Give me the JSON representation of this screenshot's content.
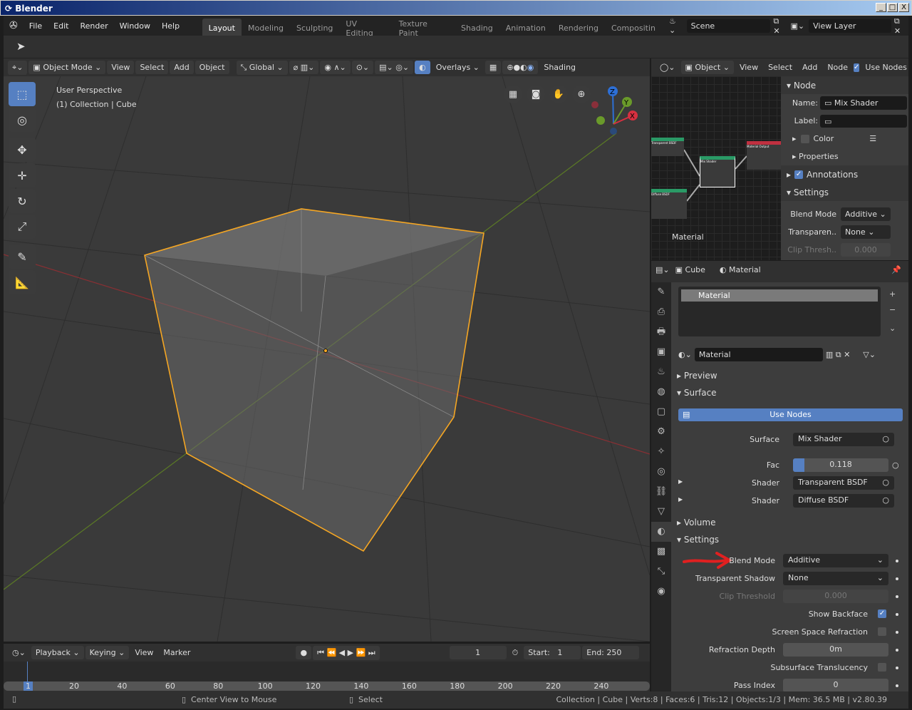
{
  "window": {
    "title": "Blender",
    "min": "_",
    "max": "□",
    "close": "X"
  },
  "menu": [
    "File",
    "Edit",
    "Render",
    "Window",
    "Help"
  ],
  "workspaces": [
    "Layout",
    "Modeling",
    "Sculpting",
    "UV Editing",
    "Texture Paint",
    "Shading",
    "Animation",
    "Rendering",
    "Compositin"
  ],
  "scene": {
    "name": "Scene",
    "view_layer": "View Layer"
  },
  "viewport": {
    "mode": "Object Mode",
    "menus": [
      "View",
      "Select",
      "Add",
      "Object"
    ],
    "orientation": "Global",
    "overlays": "Overlays",
    "shading": "Shading",
    "info_line1": "User Perspective",
    "info_line2": "(1) Collection | Cube",
    "gizmo": {
      "x": "X",
      "y": "Y",
      "z": "Z"
    }
  },
  "node_editor": {
    "object": "Object",
    "menus": [
      "View",
      "Select",
      "Add",
      "Node"
    ],
    "use_nodes": "Use Nodes",
    "material_label": "Material",
    "nodes": {
      "transparent": "Transparent BSDF",
      "diffuse": "Diffuse BSDF",
      "mix": "Mix Shader",
      "output": "Material Output"
    },
    "panel": {
      "node": "Node",
      "name_label": "Name:",
      "name_value": "Mix Shader",
      "label_label": "Label:",
      "color": "Color",
      "properties": "Properties",
      "annotations": "Annotations",
      "settings": "Settings",
      "blend_mode": "Blend Mode",
      "blend_value": "Additive",
      "transparent": "Transparen..",
      "transparent_value": "None",
      "clip": "Clip Thresh..",
      "clip_value": "0.000"
    }
  },
  "properties": {
    "object": "Cube",
    "material": "Material",
    "slot": "Material",
    "mat_name": "Material",
    "preview": "Preview",
    "surface_header": "Surface",
    "use_nodes": "Use Nodes",
    "surface_label": "Surface",
    "surface_value": "Mix Shader",
    "fac_label": "Fac",
    "fac_value": "0.118",
    "fac_fraction": 0.118,
    "shader1_label": "Shader",
    "shader1_value": "Transparent BSDF",
    "shader2_label": "Shader",
    "shader2_value": "Diffuse BSDF",
    "volume": "Volume",
    "settings": "Settings",
    "blend_mode": "Blend Mode",
    "blend_value": "Additive",
    "transparent_shadow": "Transparent Shadow",
    "shadow_value": "None",
    "clip_threshold": "Clip Threshold",
    "clip_value": "0.000",
    "show_backface": "Show Backface",
    "ssr": "Screen Space Refraction",
    "refraction_depth": "Refraction Depth",
    "refraction_value": "0m",
    "sss": "Subsurface Translucency",
    "pass_index": "Pass Index",
    "pass_value": "0"
  },
  "timeline": {
    "menus": [
      "Playback",
      "Keying",
      "View",
      "Marker"
    ],
    "current": "1",
    "start_label": "Start:",
    "start": "1",
    "end_label": "End:",
    "end": "250",
    "ticks": [
      "1",
      "20",
      "40",
      "60",
      "80",
      "100",
      "120",
      "140",
      "160",
      "180",
      "200",
      "220",
      "240"
    ]
  },
  "status": {
    "left": "Center View to Mouse",
    "mid": "Select",
    "stats": "Collection | Cube | Verts:8 | Faces:6 | Tris:12 | Objects:1/3 | Mem: 36.5 MB | v2.80.39"
  },
  "colors": {
    "accent": "#5680c2",
    "selection": "#f5a623",
    "annotation_arrow": "#e02020"
  }
}
